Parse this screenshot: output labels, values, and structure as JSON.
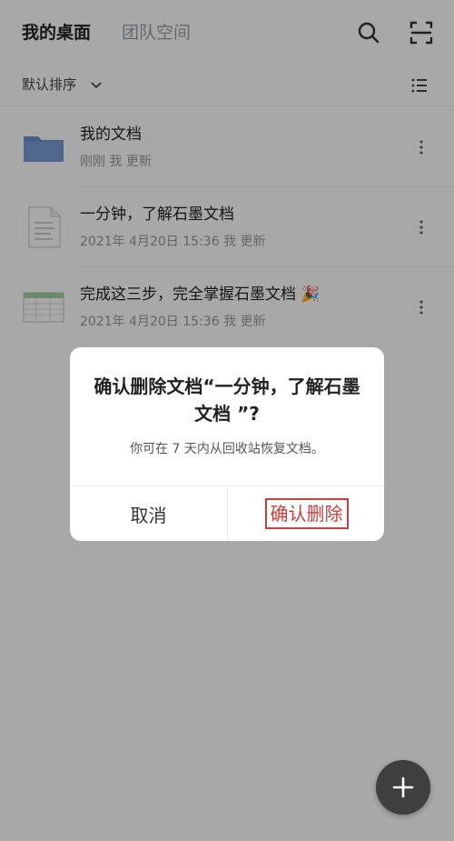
{
  "header": {
    "tab_active": "我的桌面",
    "tab_inactive": "团队空间"
  },
  "sortbar": {
    "label": "默认排序"
  },
  "files": [
    {
      "title": "我的文档",
      "meta": "刚刚 我 更新",
      "icon": "folder-icon"
    },
    {
      "title": "一分钟，了解石墨文档",
      "meta": "2021年 4月20日 15:36 我 更新",
      "icon": "document-icon"
    },
    {
      "title": "完成这三步，完全掌握石墨文档 🎉",
      "meta": "2021年 4月20日 15:36 我 更新",
      "icon": "spreadsheet-icon"
    }
  ],
  "dialog": {
    "title": "确认删除文档“一分钟，了解石墨文档 ”?",
    "message": "你可在 7 天内从回收站恢复文档。",
    "cancel_label": "取消",
    "confirm_label": "确认删除"
  },
  "colors": {
    "accent_red": "#d13b3b",
    "folder_blue": "#6f8fc9",
    "fab": "#3f3f3f"
  }
}
